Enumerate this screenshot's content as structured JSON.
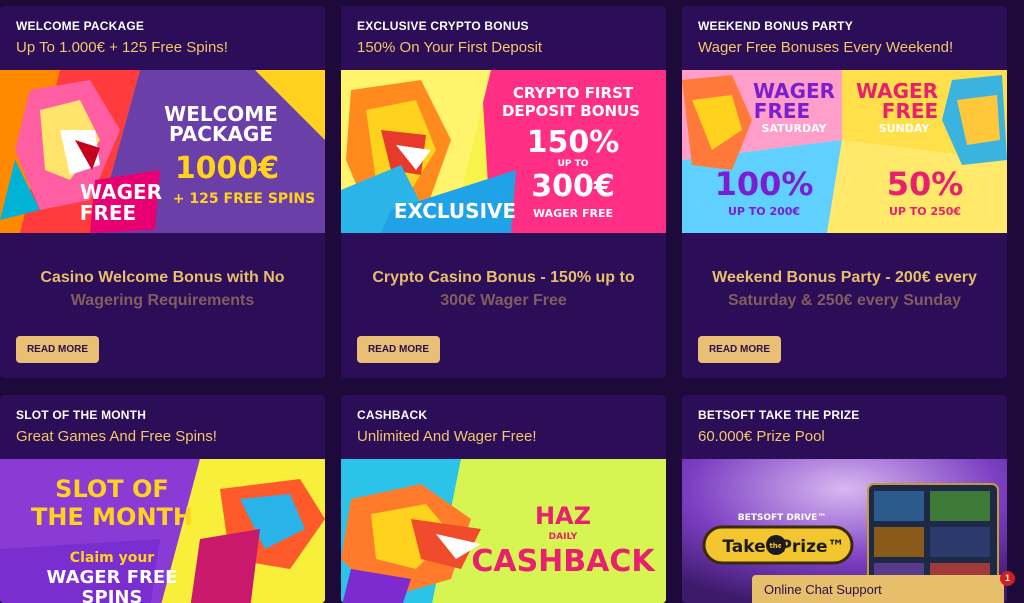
{
  "cards": [
    {
      "eyebrow": "WELCOME PACKAGE",
      "subtitle": "Up To 1.000€ + 125 Free Spins!",
      "banner": {
        "line1": "WELCOME",
        "line2": "PACKAGE",
        "amount": "1000€",
        "extra": "+ 125 FREE SPINS",
        "tag1": "WAGER",
        "tag2": "FREE"
      },
      "headline_1": "Casino Welcome Bonus with No",
      "headline_2": "Wagering Requirements",
      "button": "READ MORE"
    },
    {
      "eyebrow": "EXCLUSIVE CRYPTO BONUS",
      "subtitle": "150% On Your First Deposit",
      "banner": {
        "line1": "CRYPTO FIRST",
        "line2": "DEPOSIT BONUS",
        "percent": "150%",
        "upto": "UP TO",
        "amount": "300€",
        "wager": "WAGER FREE",
        "exclusive": "EXCLUSIVE"
      },
      "headline_1": "Crypto Casino Bonus - 150% up to",
      "headline_2": "300€ Wager Free",
      "button": "READ MORE"
    },
    {
      "eyebrow": "WEEKEND BONUS PARTY",
      "subtitle": "Wager Free Bonuses Every Weekend!",
      "banner": {
        "wager": "WAGER",
        "free": "FREE",
        "saturday": "SATURDAY",
        "sunday": "SUNDAY",
        "pct1": "100%",
        "upto1": "UP TO 200€",
        "pct2": "50%",
        "upto2": "UP TO 250€"
      },
      "headline_1": "Weekend Bonus Party - 200€ every",
      "headline_2": "Saturday & 250€ every Sunday",
      "button": "READ MORE"
    },
    {
      "eyebrow": "SLOT OF THE MONTH",
      "subtitle": "Great Games And Free Spins!",
      "banner": {
        "line1": "SLOT OF",
        "line2": "THE MONTH",
        "claim": "Claim your",
        "wager": "WAGER FREE",
        "spins": "SPINS"
      }
    },
    {
      "eyebrow": "CASHBACK",
      "subtitle": "Unlimited And Wager Free!",
      "banner": {
        "haz": "HAZ",
        "daily": "DAILY",
        "cashback": "CASHBACK"
      }
    },
    {
      "eyebrow": "BETSOFT TAKE THE PRIZE",
      "subtitle": "60.000€ Prize Pool",
      "banner": {
        "brand": "BETSOFT DRIVE™",
        "take": "Take",
        "the": "the",
        "prize": "Prize™"
      }
    }
  ],
  "chat": {
    "label": "Online Chat Support",
    "badge": "1"
  },
  "colors": {
    "background": "#1e0a3a",
    "card": "#2c0d57",
    "gold": "#e9bf76",
    "accent_pink": "#f0287a"
  }
}
